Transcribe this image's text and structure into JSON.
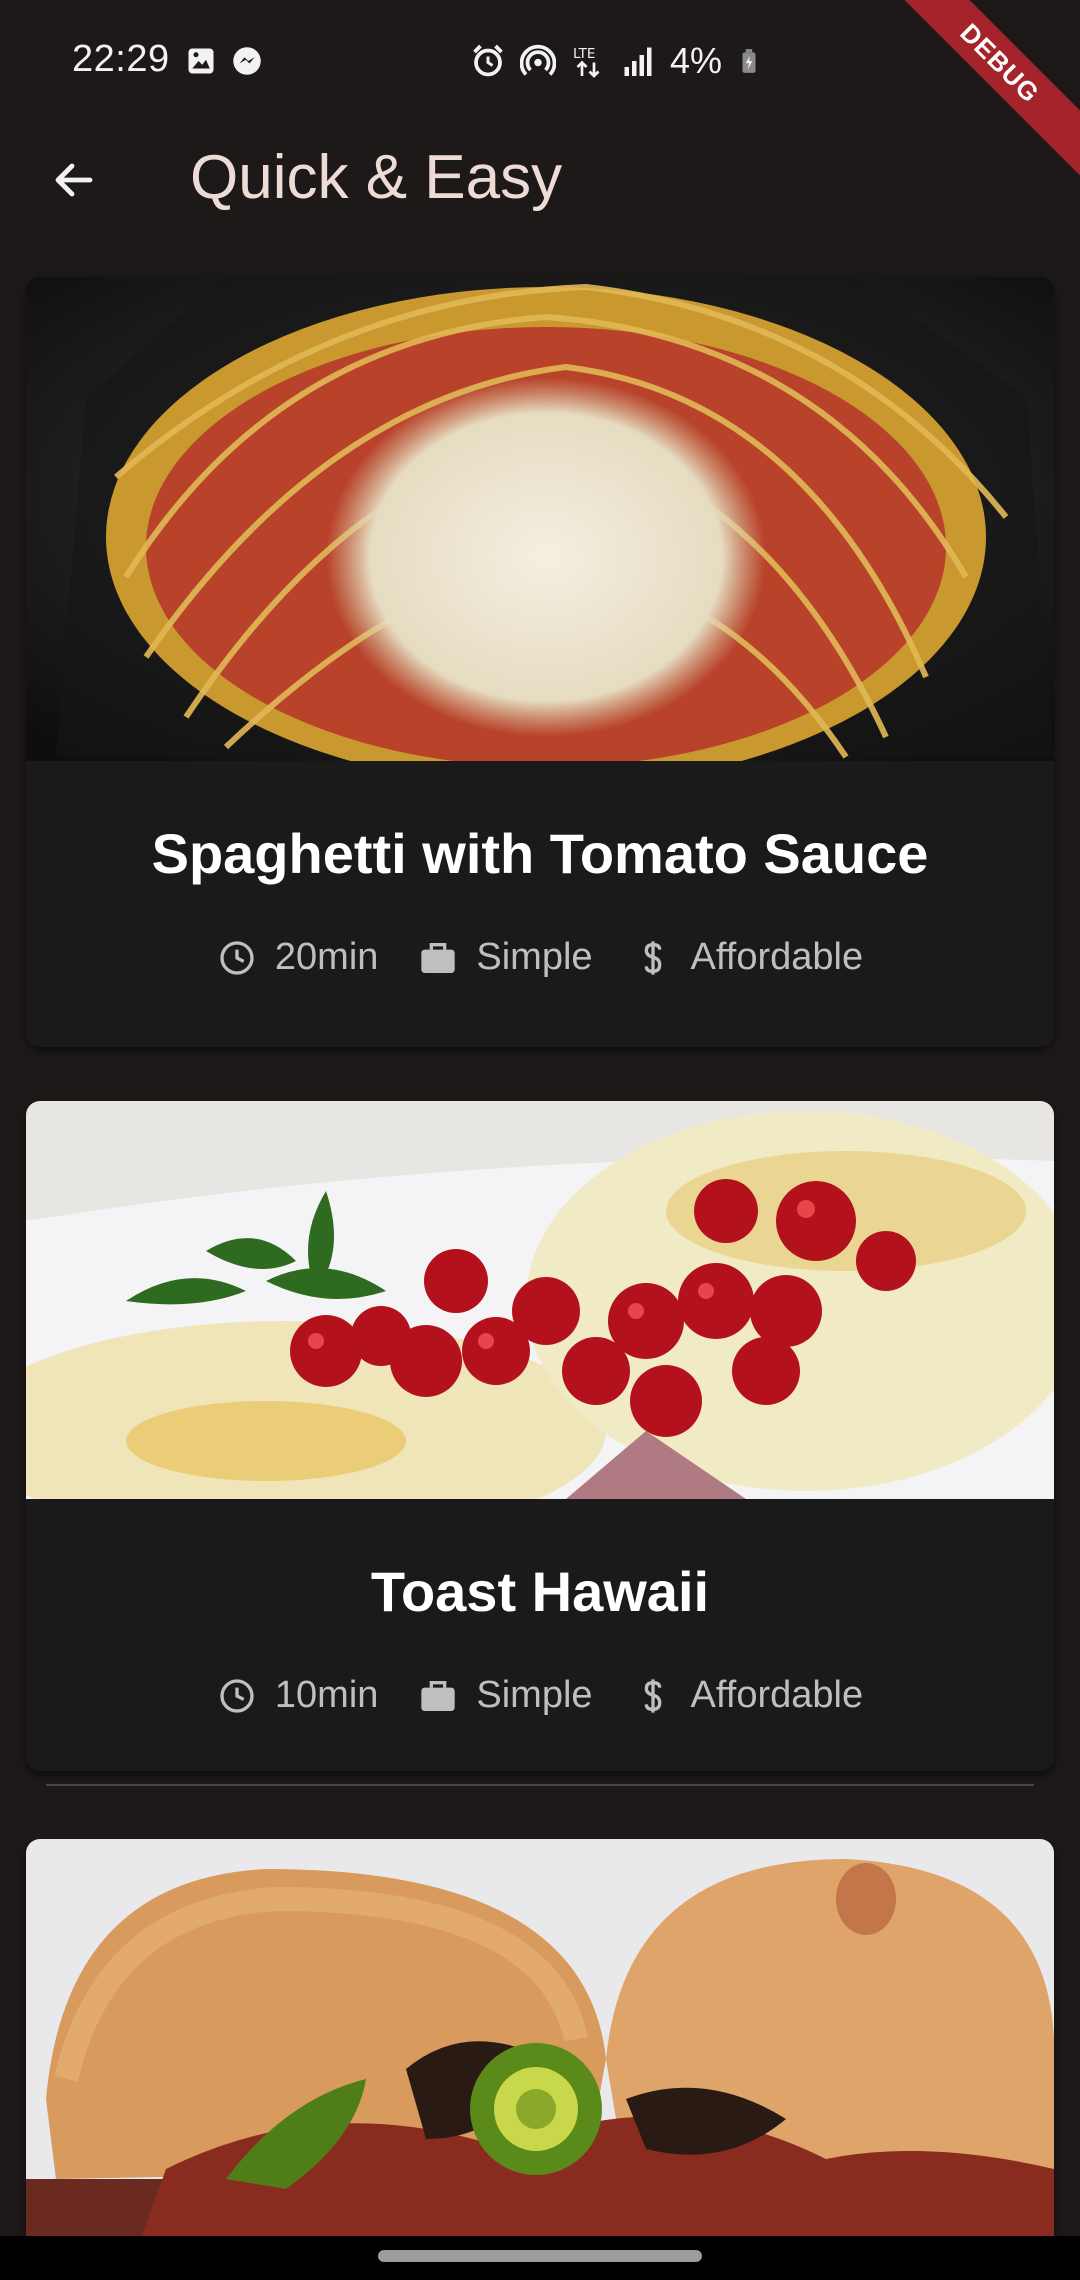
{
  "status_bar": {
    "time": "22:29",
    "battery": "4%",
    "icons": [
      "gallery-icon",
      "messenger-icon",
      "alarm-icon",
      "hotspot-icon",
      "lte-icon",
      "signal-icon",
      "battery-charging-icon"
    ]
  },
  "debug_banner": "DEBUG",
  "app_bar": {
    "title": "Quick & Easy",
    "back_icon": "arrow-left-icon"
  },
  "recipes": [
    {
      "title": "Spaghetti with Tomato Sauce",
      "duration": "20min",
      "complexity": "Simple",
      "affordability": "Affordable"
    },
    {
      "title": "Toast Hawaii",
      "duration": "10min",
      "complexity": "Simple",
      "affordability": "Affordable"
    },
    {
      "title": "",
      "duration": "",
      "complexity": "",
      "affordability": ""
    }
  ],
  "colors": {
    "background": "#1d1918",
    "card": "#1a1a1a",
    "title_text": "#efdbd6",
    "debug_ribbon": "#a5232a"
  }
}
